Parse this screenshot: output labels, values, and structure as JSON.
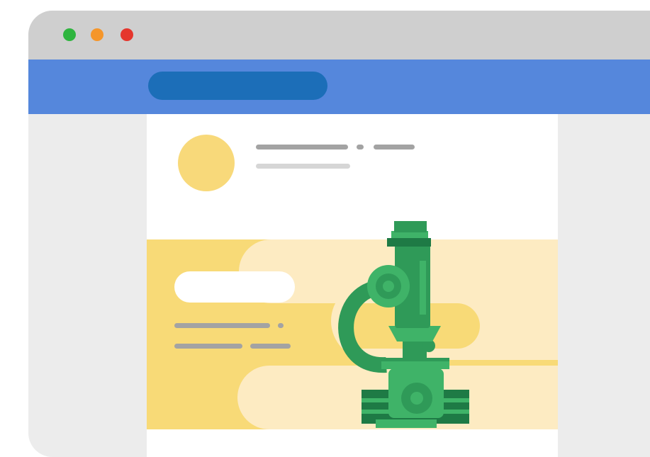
{
  "window": {
    "controls": [
      "close",
      "minimize",
      "zoom"
    ],
    "traffic_light_colors": {
      "close": "#2fb53f",
      "minimize": "#f5962a",
      "zoom": "#e5362d"
    }
  },
  "browser": {
    "bar_color": "#5587dc",
    "search_color": "#1c6eb8"
  },
  "page": {
    "avatar_color": "#f8d97a",
    "card_color": "#f8da77",
    "illustration": "microscope-icon"
  },
  "colors": {
    "green_dark": "#1e7a45",
    "green_mid": "#2f9a58",
    "green_light": "#3fb368",
    "cream": "#fdebc2"
  }
}
